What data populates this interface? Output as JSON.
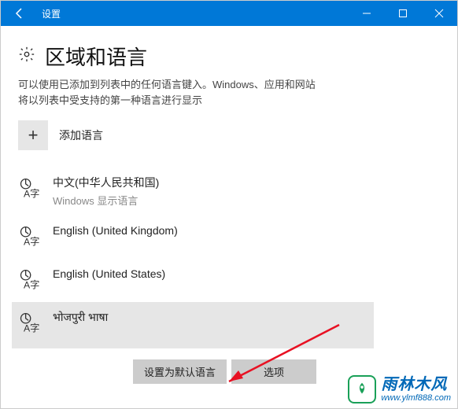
{
  "titlebar": {
    "title": "设置"
  },
  "header": {
    "title": "区域和语言"
  },
  "description": {
    "line1": "可以使用已添加到列表中的任何语言键入。Windows、应用和网站",
    "line2": "将以列表中受支持的第一种语言进行显示"
  },
  "add_lang": {
    "plus": "+",
    "label": "添加语言"
  },
  "languages": [
    {
      "name": "中文(中华人民共和国)",
      "sub": "Windows 显示语言"
    },
    {
      "name": "English (United Kingdom)",
      "sub": ""
    },
    {
      "name": "English (United States)",
      "sub": ""
    },
    {
      "name": "भोजपुरी भाषा",
      "sub": ""
    }
  ],
  "buttons": {
    "set_default": "设置为默认语言",
    "options": "选项"
  },
  "watermark": {
    "title": "雨林木风",
    "url": "www.ylmf888.com"
  }
}
